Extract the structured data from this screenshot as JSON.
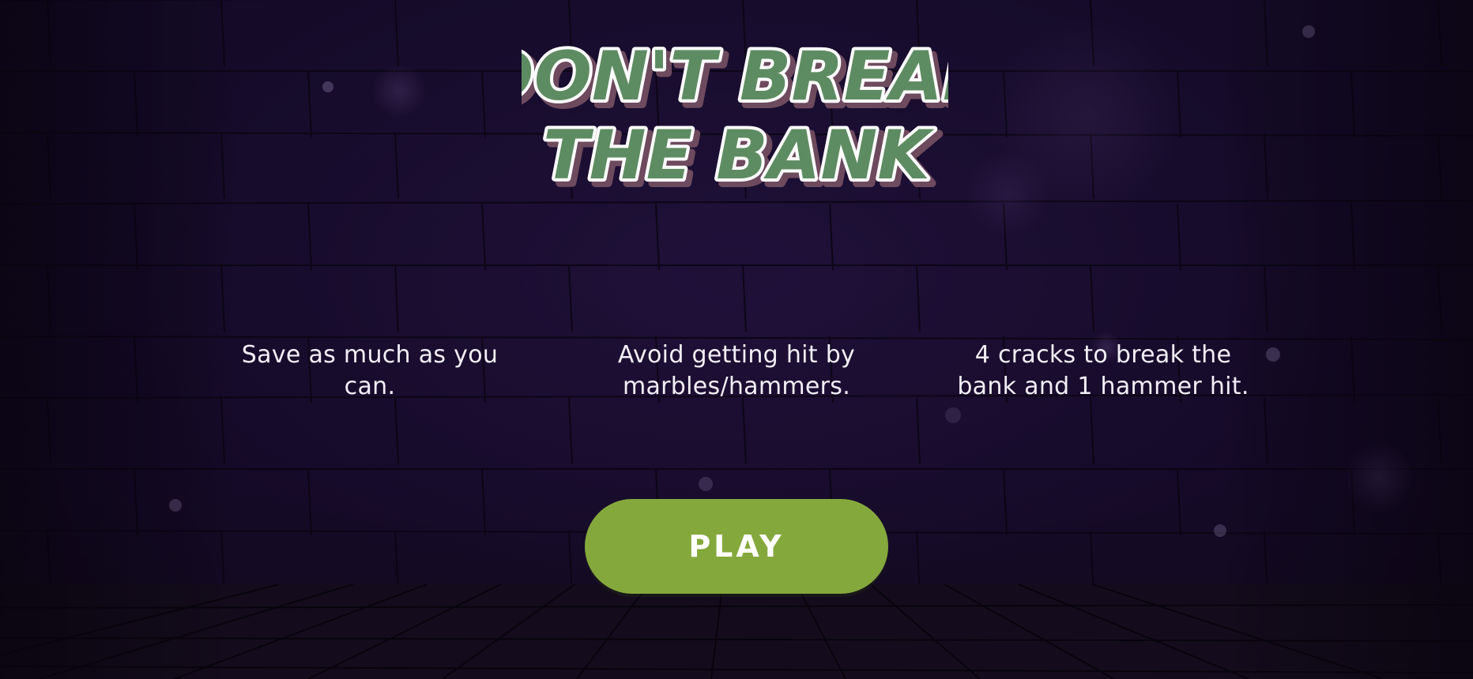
{
  "title": {
    "line1": "DON'T BREAK",
    "line2": "THE BANK"
  },
  "instructions": [
    {
      "line1": "Save as much as you",
      "line2": "can."
    },
    {
      "line1": "Avoid getting hit by",
      "line2": "marbles/hammers."
    },
    {
      "line1": "4 cracks to break the",
      "line2": "bank and 1 hammer hit."
    }
  ],
  "play_button": {
    "label": "PLAY"
  },
  "colors": {
    "background": "#150b29",
    "title_fill": "#5e8c62",
    "title_outline": "#ffffff",
    "title_shadow": "#6e4a5e",
    "play_button": "#85a83d",
    "text": "#f2eef6"
  }
}
